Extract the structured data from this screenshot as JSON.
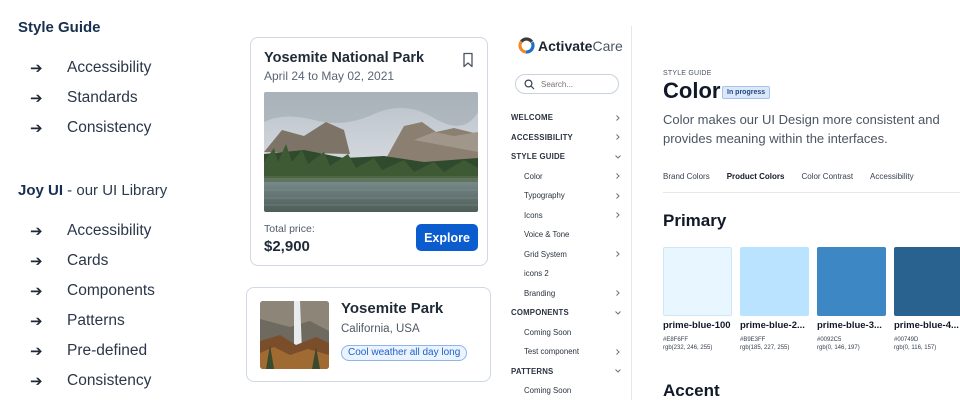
{
  "left": {
    "section1": {
      "title": "Style Guide",
      "items": [
        "Accessibility",
        "Standards",
        "Consistency"
      ]
    },
    "section2": {
      "title_bold": "Joy UI",
      "title_rest": " - our UI Library",
      "items": [
        "Accessibility",
        "Cards",
        "Components",
        "Patterns",
        "Pre-defined",
        "Consistency"
      ]
    },
    "arrow": "➔"
  },
  "card1": {
    "title": "Yosemite National Park",
    "dates": "April 24 to May 02, 2021",
    "price_label": "Total price:",
    "price": "$2,900",
    "button": "Explore"
  },
  "card2": {
    "title": "Yosemite Park",
    "location": "California, USA",
    "chip": "Cool weather all day long"
  },
  "sidebar": {
    "logo_bold": "Activate",
    "logo_light": "Care",
    "search_placeholder": "Search...",
    "nav": [
      {
        "label": "WELCOME",
        "kind": "cat",
        "chevron": "right"
      },
      {
        "label": "ACCESSIBILITY",
        "kind": "cat",
        "chevron": "right"
      },
      {
        "label": "STYLE GUIDE",
        "kind": "cat",
        "chevron": "down"
      },
      {
        "label": "Color",
        "kind": "sub",
        "chevron": "right"
      },
      {
        "label": "Typography",
        "kind": "sub",
        "chevron": "right"
      },
      {
        "label": "Icons",
        "kind": "sub",
        "chevron": "right"
      },
      {
        "label": "Voice & Tone",
        "kind": "sub",
        "chevron": ""
      },
      {
        "label": "Grid System",
        "kind": "sub",
        "chevron": "right"
      },
      {
        "label": "icons 2",
        "kind": "sub",
        "chevron": ""
      },
      {
        "label": "Branding",
        "kind": "sub",
        "chevron": "right"
      },
      {
        "label": "COMPONENTS",
        "kind": "cat",
        "chevron": "down"
      },
      {
        "label": "Coming Soon",
        "kind": "sub",
        "chevron": ""
      },
      {
        "label": "Test component",
        "kind": "sub",
        "chevron": "right"
      },
      {
        "label": "PATTERNS",
        "kind": "cat",
        "chevron": "down"
      },
      {
        "label": "Coming Soon",
        "kind": "sub",
        "chevron": ""
      }
    ]
  },
  "main": {
    "breadcrumb": "STYLE GUIDE",
    "title": "Color",
    "badge": "In progress",
    "description": "Color makes our UI Design more consistent and provides meaning within the interfaces.",
    "tabs": [
      {
        "label": "Brand Colors",
        "active": false
      },
      {
        "label": "Product Colors",
        "active": true
      },
      {
        "label": "Color Contrast",
        "active": false
      },
      {
        "label": "Accessibility",
        "active": false
      }
    ],
    "primary_heading": "Primary",
    "swatches": [
      {
        "name": "prime-blue-100",
        "hex": "#E8F6FF",
        "rgb": "rgb(232, 246, 255)",
        "color": "#E8F6FF"
      },
      {
        "name": "prime-blue-2...",
        "hex": "#B9E3FF",
        "rgb": "rgb(185, 227, 255)",
        "color": "#B9E3FF"
      },
      {
        "name": "prime-blue-3...",
        "hex": "#0092C5",
        "rgb": "rgb(0, 146, 197)",
        "color": "#3D87C5"
      },
      {
        "name": "prime-blue-4...",
        "hex": "#00749D",
        "rgb": "rgb(0, 116, 157)",
        "color": "#2A628F"
      }
    ],
    "accent_heading": "Accent"
  }
}
